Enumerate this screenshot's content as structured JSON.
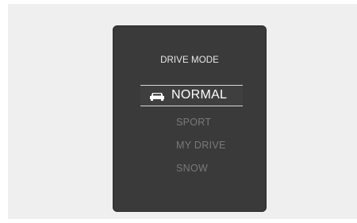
{
  "panel": {
    "title": "DRIVE MODE",
    "selected": {
      "label": "NORMAL",
      "icon": "car-icon"
    },
    "options": [
      "SPORT",
      "MY DRIVE",
      "SNOW"
    ]
  },
  "colors": {
    "panel_bg": "#3a3a3a",
    "selected_text": "#ffffff",
    "inactive_text": "#7a7a7a",
    "background": "#efefef"
  }
}
